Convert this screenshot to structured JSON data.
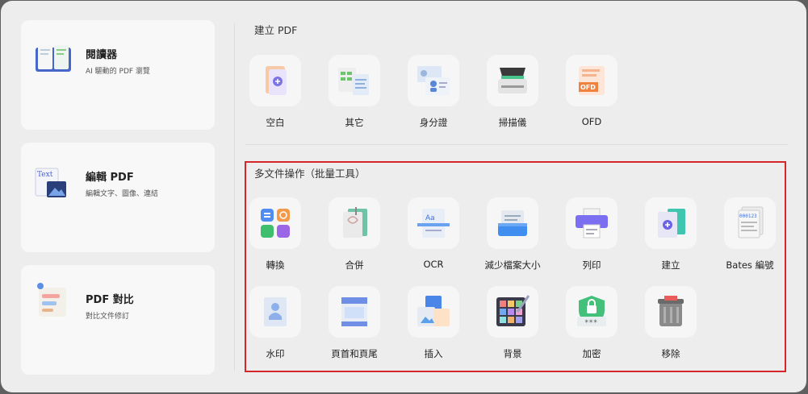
{
  "sidebar": {
    "reader": {
      "title": "閱讀器",
      "subtitle": "AI 驅動的 PDF 瀏覽"
    },
    "editor": {
      "title": "編輯 PDF",
      "subtitle": "編輯文字、圖像、連結",
      "icon_text": "Text"
    },
    "compare": {
      "title": "PDF 對比",
      "subtitle": "對比文件修訂"
    }
  },
  "create_section": {
    "title": "建立 PDF",
    "items": [
      {
        "label": "空白",
        "icon": "blank-page-icon"
      },
      {
        "label": "其它",
        "icon": "other-files-icon"
      },
      {
        "label": "身分證",
        "icon": "id-card-icon"
      },
      {
        "label": "掃描儀",
        "icon": "scanner-icon"
      },
      {
        "label": "OFD",
        "icon": "ofd-icon",
        "icon_text": "OFD"
      }
    ]
  },
  "batch_section": {
    "title": "多文件操作（批量工具）",
    "row1": [
      {
        "label": "轉換",
        "icon": "convert-icon"
      },
      {
        "label": "合併",
        "icon": "merge-icon"
      },
      {
        "label": "OCR",
        "icon": "ocr-icon",
        "icon_text": "Aa"
      },
      {
        "label": "減少檔案大小",
        "icon": "compress-icon"
      },
      {
        "label": "列印",
        "icon": "print-icon"
      },
      {
        "label": "建立",
        "icon": "create-icon"
      },
      {
        "label": "Bates 編號",
        "icon": "bates-icon",
        "icon_text": "000123"
      }
    ],
    "row2": [
      {
        "label": "水印",
        "icon": "watermark-icon"
      },
      {
        "label": "頁首和頁尾",
        "icon": "header-footer-icon"
      },
      {
        "label": "插入",
        "icon": "insert-icon"
      },
      {
        "label": "背景",
        "icon": "background-icon"
      },
      {
        "label": "加密",
        "icon": "encrypt-icon",
        "icon_text": "***"
      },
      {
        "label": "移除",
        "icon": "remove-icon"
      }
    ]
  },
  "colors": {
    "highlight_border": "#d6262c",
    "accent_blue": "#3b6fd8"
  }
}
